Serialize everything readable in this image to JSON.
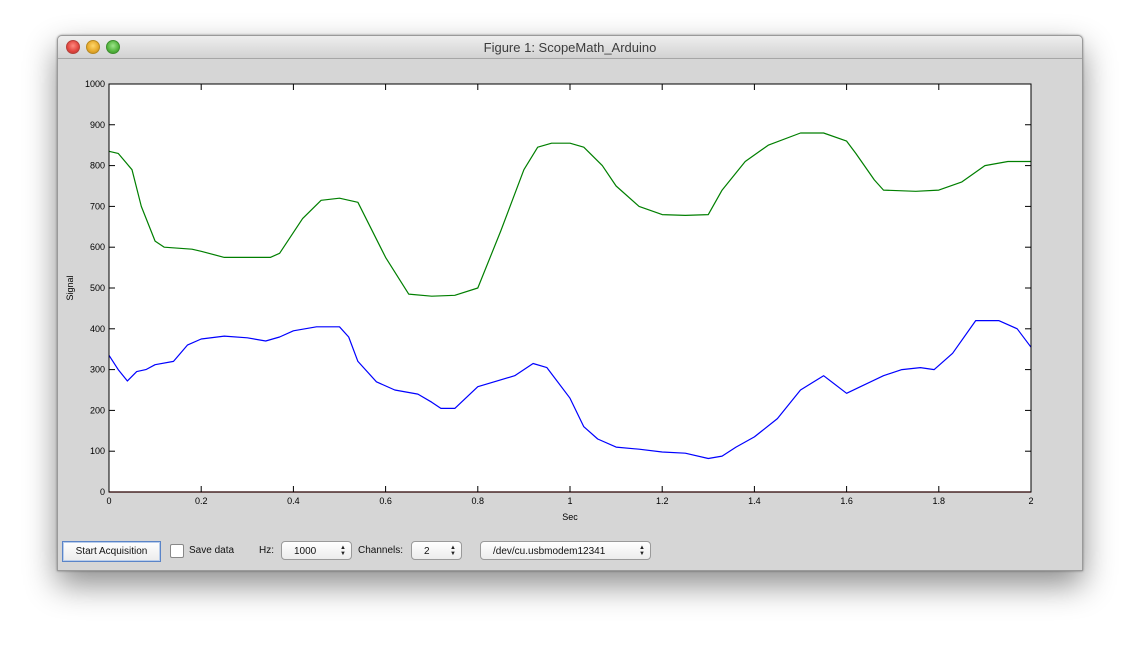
{
  "window": {
    "title": "Figure 1: ScopeMath_Arduino"
  },
  "controls": {
    "start_label": "Start Acquisition",
    "save_label": "Save data",
    "save_checked": false,
    "hz_label": "Hz:",
    "hz_value": "1000",
    "channels_label": "Channels:",
    "channels_value": "2",
    "port_value": "/dev/cu.usbmodem12341"
  },
  "chart_data": {
    "type": "line",
    "xlabel": "Sec",
    "ylabel": "Signal",
    "xlim": [
      0,
      2
    ],
    "ylim": [
      0,
      1000
    ],
    "xticks": [
      0,
      0.2,
      0.4,
      0.6,
      0.8,
      1,
      1.2,
      1.4,
      1.6,
      1.8,
      2
    ],
    "xtick_labels": [
      "0",
      "0.2",
      "0.4",
      "0.6",
      "0.8",
      "1",
      "1.2",
      "1.4",
      "1.6",
      "1.8",
      "2"
    ],
    "yticks": [
      0,
      100,
      200,
      300,
      400,
      500,
      600,
      700,
      800,
      900,
      1000
    ],
    "ytick_labels": [
      "0",
      "100",
      "200",
      "300",
      "400",
      "500",
      "600",
      "700",
      "800",
      "900",
      "1000"
    ],
    "grid": false,
    "series": [
      {
        "color": "#007f00",
        "x": [
          0,
          0.02,
          0.05,
          0.07,
          0.1,
          0.12,
          0.18,
          0.2,
          0.25,
          0.3,
          0.35,
          0.37,
          0.42,
          0.46,
          0.5,
          0.54,
          0.6,
          0.65,
          0.7,
          0.75,
          0.8,
          0.85,
          0.9,
          0.93,
          0.96,
          1.0,
          1.03,
          1.07,
          1.1,
          1.15,
          1.2,
          1.25,
          1.3,
          1.33,
          1.38,
          1.43,
          1.5,
          1.55,
          1.6,
          1.62,
          1.66,
          1.68,
          1.75,
          1.8,
          1.85,
          1.9,
          1.95,
          2.0
        ],
        "y": [
          835,
          830,
          790,
          700,
          615,
          600,
          595,
          590,
          575,
          575,
          575,
          585,
          670,
          715,
          720,
          710,
          575,
          485,
          480,
          482,
          500,
          640,
          790,
          845,
          855,
          855,
          845,
          800,
          750,
          700,
          680,
          678,
          680,
          740,
          810,
          850,
          880,
          880,
          860,
          830,
          765,
          740,
          737,
          740,
          760,
          800,
          810,
          810
        ]
      },
      {
        "color": "#0000ff",
        "x": [
          0,
          0.02,
          0.04,
          0.06,
          0.08,
          0.1,
          0.14,
          0.17,
          0.2,
          0.25,
          0.3,
          0.34,
          0.37,
          0.4,
          0.45,
          0.5,
          0.52,
          0.54,
          0.58,
          0.62,
          0.67,
          0.7,
          0.72,
          0.75,
          0.8,
          0.88,
          0.92,
          0.95,
          1.0,
          1.03,
          1.06,
          1.1,
          1.15,
          1.2,
          1.25,
          1.3,
          1.33,
          1.36,
          1.4,
          1.45,
          1.5,
          1.55,
          1.6,
          1.63,
          1.68,
          1.72,
          1.76,
          1.79,
          1.83,
          1.88,
          1.93,
          1.97,
          2.0
        ],
        "y": [
          335,
          300,
          272,
          295,
          300,
          312,
          320,
          360,
          375,
          382,
          378,
          370,
          380,
          395,
          405,
          405,
          380,
          320,
          270,
          250,
          240,
          220,
          205,
          205,
          258,
          285,
          315,
          305,
          230,
          160,
          130,
          110,
          105,
          98,
          95,
          82,
          88,
          110,
          135,
          180,
          250,
          285,
          242,
          258,
          285,
          300,
          305,
          300,
          340,
          420,
          420,
          400,
          355
        ]
      },
      {
        "color": "#cc0000",
        "x": [
          0,
          2
        ],
        "y": [
          0,
          0
        ]
      }
    ]
  }
}
